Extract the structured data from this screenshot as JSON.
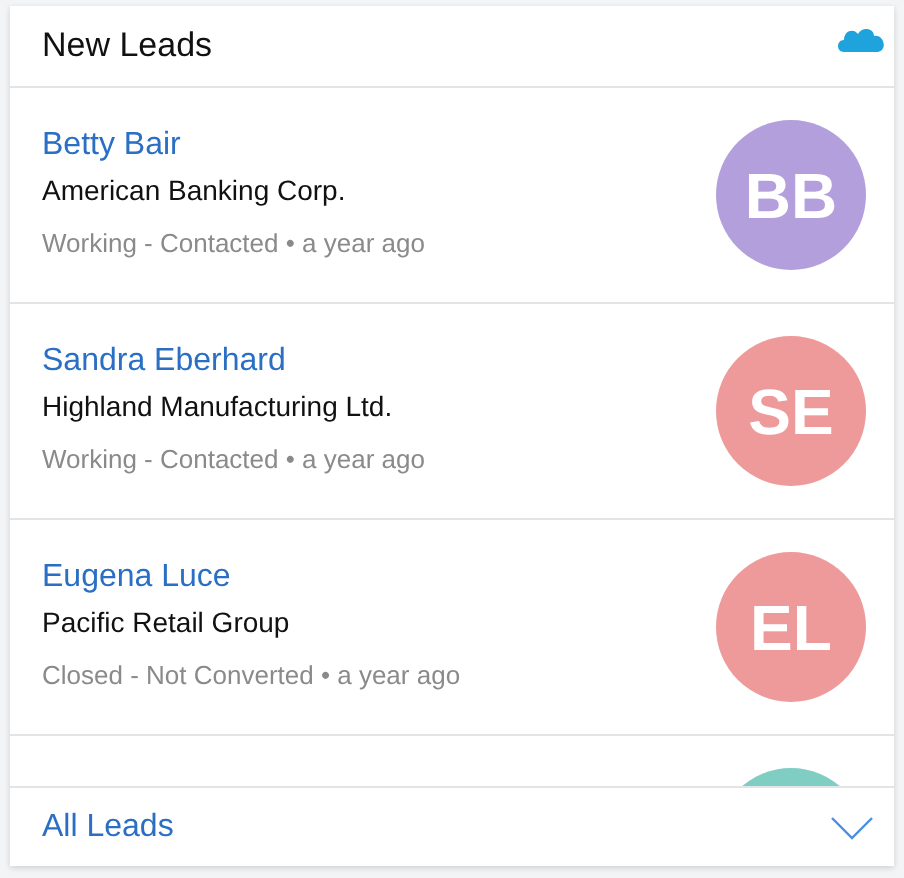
{
  "card": {
    "title": "New Leads"
  },
  "leads": [
    {
      "name": "Betty Bair",
      "company": "American Banking Corp.",
      "meta": "Working - Contacted • a year ago",
      "initials": "BB",
      "color": "#b39fdc"
    },
    {
      "name": "Sandra Eberhard",
      "company": "Highland Manufacturing Ltd.",
      "meta": "Working - Contacted • a year ago",
      "initials": "SE",
      "color": "#ef9a9a"
    },
    {
      "name": "Eugena Luce",
      "company": "Pacific Retail Group",
      "meta": "Closed - Not Converted • a year ago",
      "initials": "EL",
      "color": "#ef9a9a"
    },
    {
      "color": "#80cdc3"
    }
  ],
  "footer": {
    "link": "All Leads"
  }
}
